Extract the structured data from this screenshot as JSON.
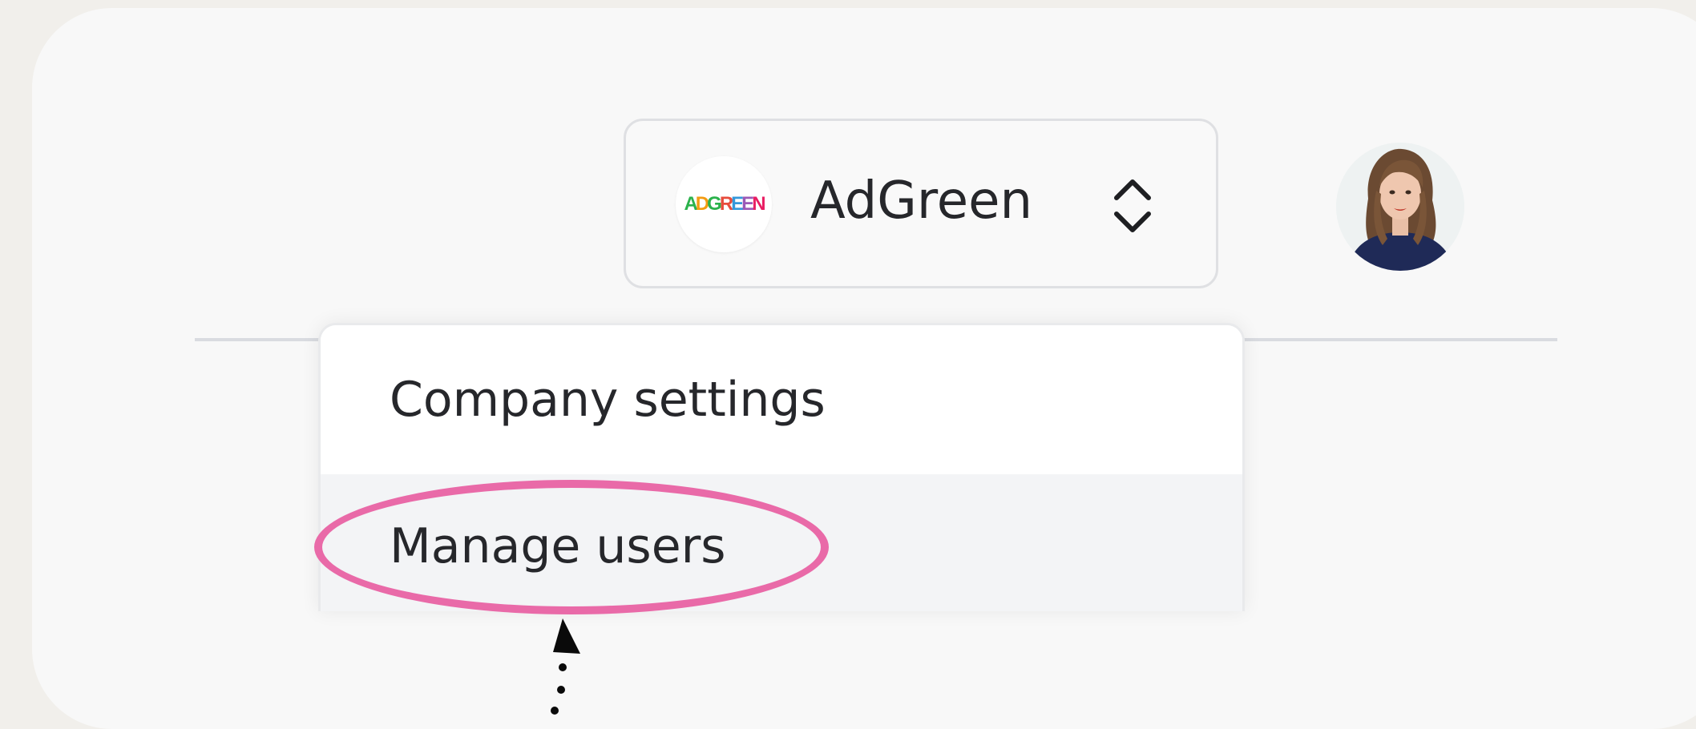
{
  "header": {
    "company_switcher": {
      "logo_text": "ADGREEN",
      "name": "AdGreen",
      "icon": "chevron-up-down-icon"
    },
    "avatar_icon": "user-avatar"
  },
  "menu": {
    "items": [
      {
        "label": "Company settings"
      },
      {
        "label": "Manage users",
        "highlighted": true
      }
    ]
  },
  "annotation": {
    "highlight_color": "#e96aa8",
    "pointer_icon": "arrow-up-icon"
  },
  "colors": {
    "background": "#f1efeb",
    "card": "#f8f8f8",
    "menu_hover": "#f3f4f6",
    "text": "#26272b"
  }
}
